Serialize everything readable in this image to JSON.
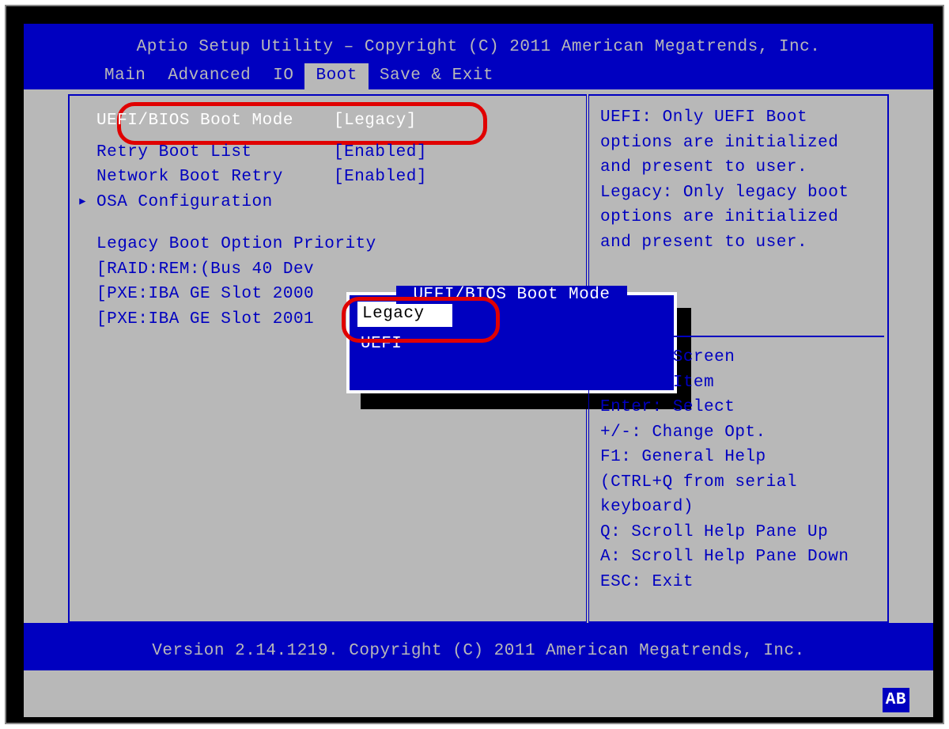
{
  "title": "Aptio Setup Utility – Copyright (C) 2011 American Megatrends, Inc.",
  "tabs": {
    "main": "Main",
    "advanced": "Advanced",
    "io": "IO",
    "boot": "Boot",
    "save_exit": "Save & Exit"
  },
  "settings": {
    "boot_mode_label": "UEFI/BIOS Boot Mode",
    "boot_mode_value": "[Legacy]",
    "retry_boot_label": "Retry Boot List",
    "retry_boot_value": "[Enabled]",
    "net_boot_label": "Network Boot Retry",
    "net_boot_value": "[Enabled]",
    "osa_label": "OSA Configuration",
    "priority_heading": "Legacy Boot Option Priority",
    "priority_items": [
      "[RAID:REM:(Bus 40 Dev",
      "[PXE:IBA GE Slot 2000",
      "[PXE:IBA GE Slot 2001"
    ]
  },
  "popup": {
    "title": " UEFI/BIOS Boot Mode ",
    "opt_legacy": "Legacy",
    "opt_uefi": "UEFI"
  },
  "help_text": "UEFI: Only UEFI Boot options are initialized and present to user. Legacy: Only legacy boot options are initialized and present to user.",
  "key_help": {
    "screen": "Select Screen",
    "item": "Select Item",
    "enter": "Enter: Select",
    "change": "+/-: Change Opt.",
    "f1": "F1: General Help",
    "ctrlq": "(CTRL+Q from serial keyboard)",
    "q": "Q: Scroll Help Pane Up",
    "a": "A: Scroll Help Pane Down",
    "esc": "ESC: Exit"
  },
  "footer": "Version 2.14.1219. Copyright (C) 2011 American Megatrends, Inc.",
  "badge": "AB"
}
